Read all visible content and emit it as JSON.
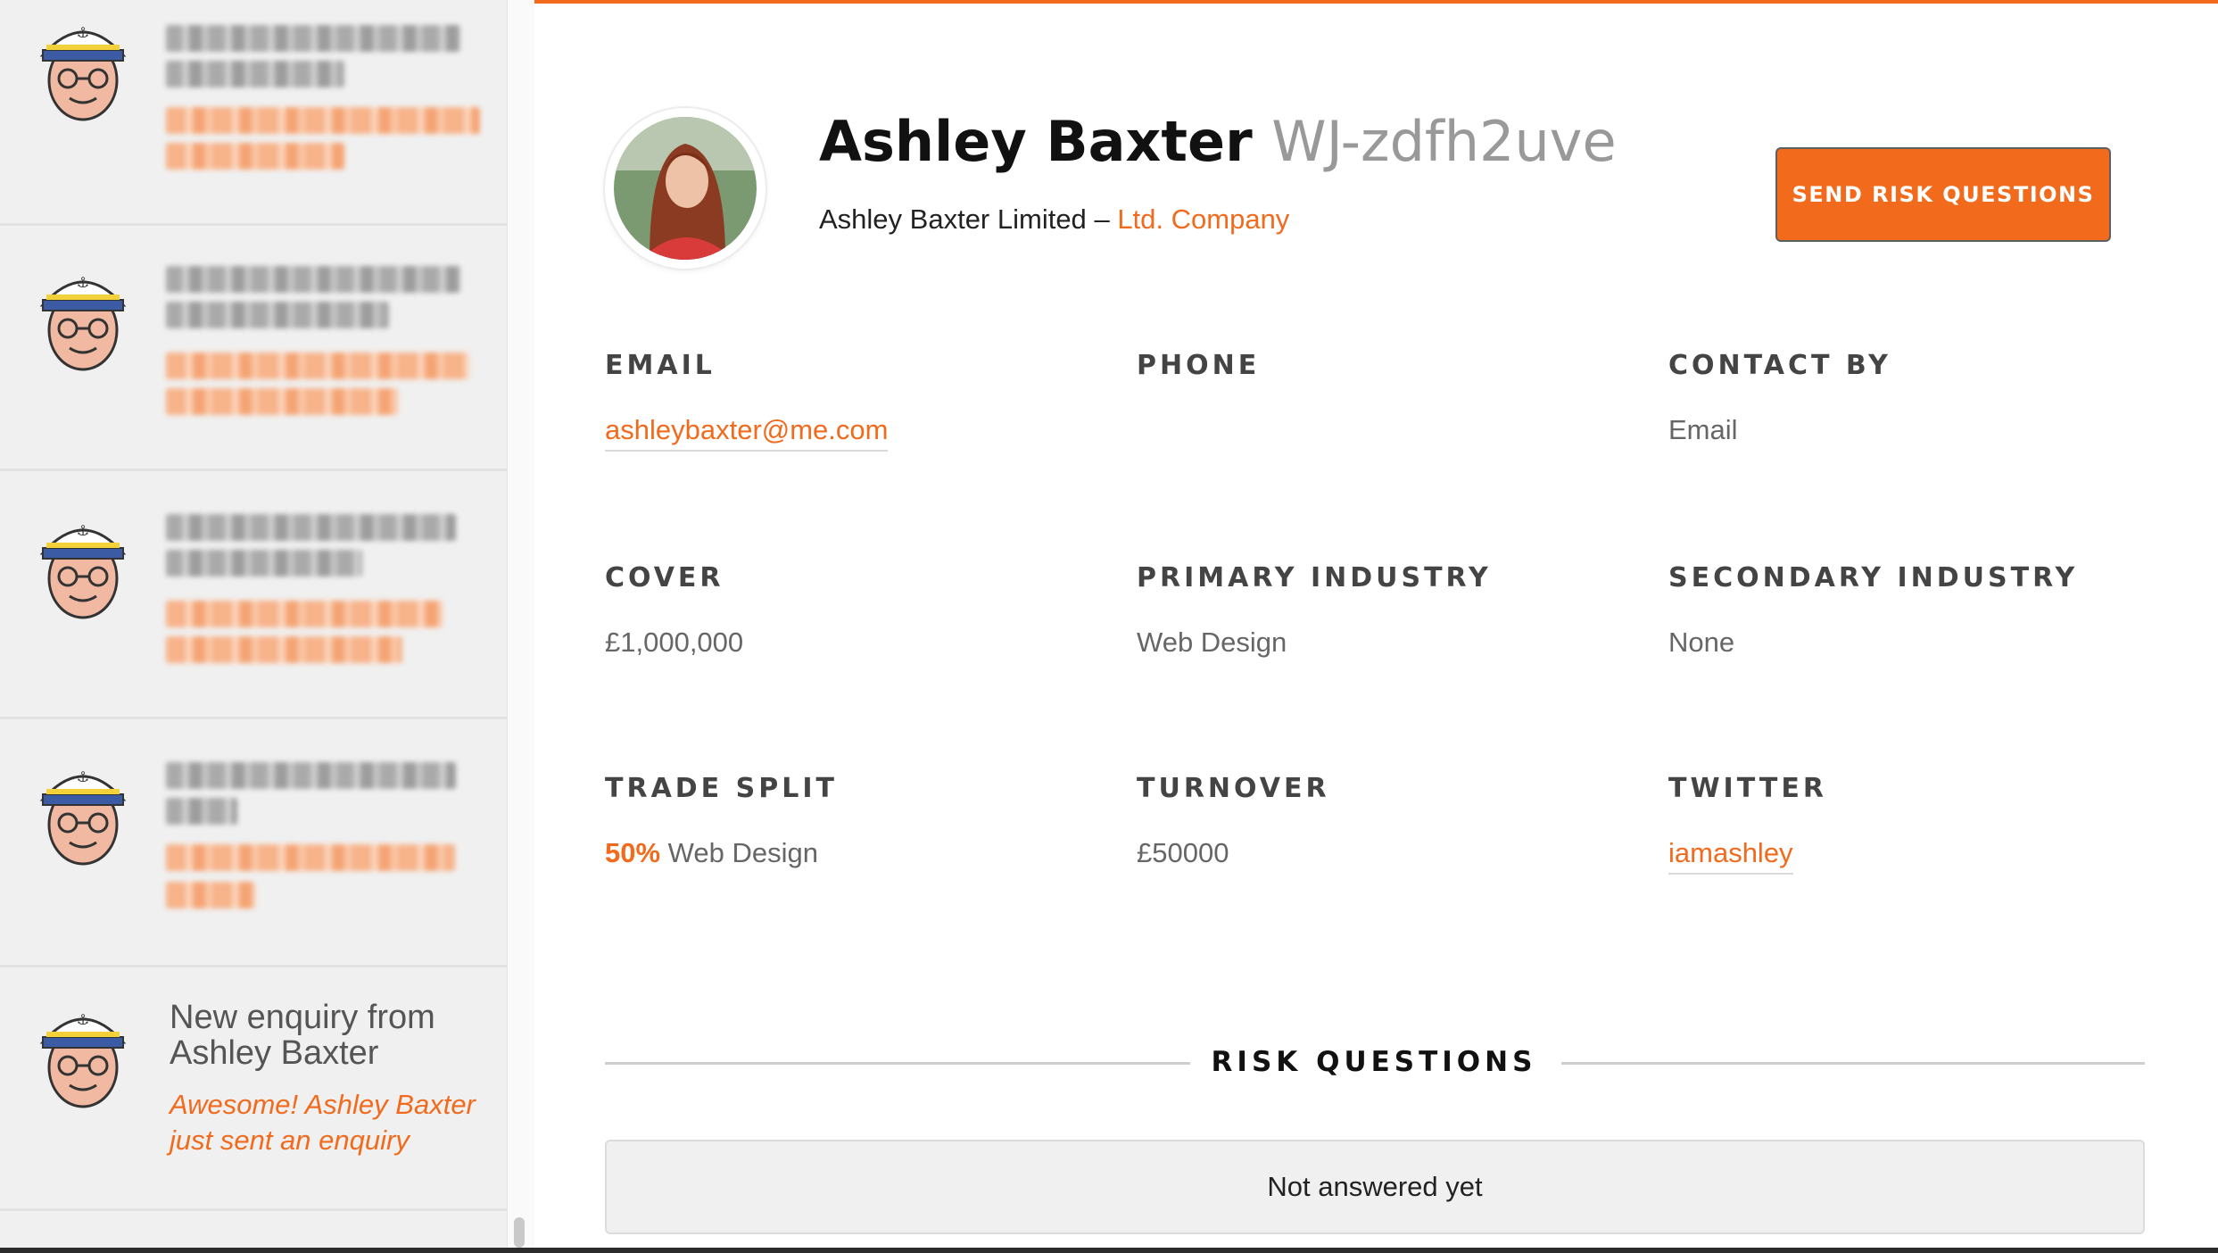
{
  "colors": {
    "accent": "#f26b1d",
    "sidebar_bg": "#f0f0f0"
  },
  "sidebar": {
    "notifications": [
      {
        "state": "blurred"
      },
      {
        "state": "blurred"
      },
      {
        "state": "blurred"
      },
      {
        "state": "blurred"
      },
      {
        "title": "New enquiry from Ashley Baxter",
        "text": "Awesome! Ashley Baxter just sent an enquiry"
      }
    ]
  },
  "profile": {
    "name": "Ashley Baxter",
    "code": "WJ-zdfh2uve",
    "company_name": "Ashley Baxter Limited",
    "separator": "–",
    "company_type": "Ltd. Company",
    "photo_icon": "profile-photo"
  },
  "actions": {
    "send_risk_questions": "SEND RISK QUESTIONS"
  },
  "fields": {
    "email": {
      "label": "EMAIL",
      "value": "ashleybaxter@me.com"
    },
    "phone": {
      "label": "PHONE",
      "value": ""
    },
    "contact_by": {
      "label": "CONTACT BY",
      "value": "Email"
    },
    "cover": {
      "label": "COVER",
      "value": "£1,000,000"
    },
    "primary_industry": {
      "label": "PRIMARY INDUSTRY",
      "value": "Web Design"
    },
    "secondary_industry": {
      "label": "SECONDARY INDUSTRY",
      "value": "None"
    },
    "trade_split": {
      "label": "TRADE SPLIT",
      "percent": "50%",
      "industry": "Web Design"
    },
    "turnover": {
      "label": "TURNOVER",
      "value": "£50000"
    },
    "twitter": {
      "label": "TWITTER",
      "value": "iamashley"
    }
  },
  "risk_questions": {
    "heading": "RISK QUESTIONS",
    "status": "Not answered yet"
  }
}
